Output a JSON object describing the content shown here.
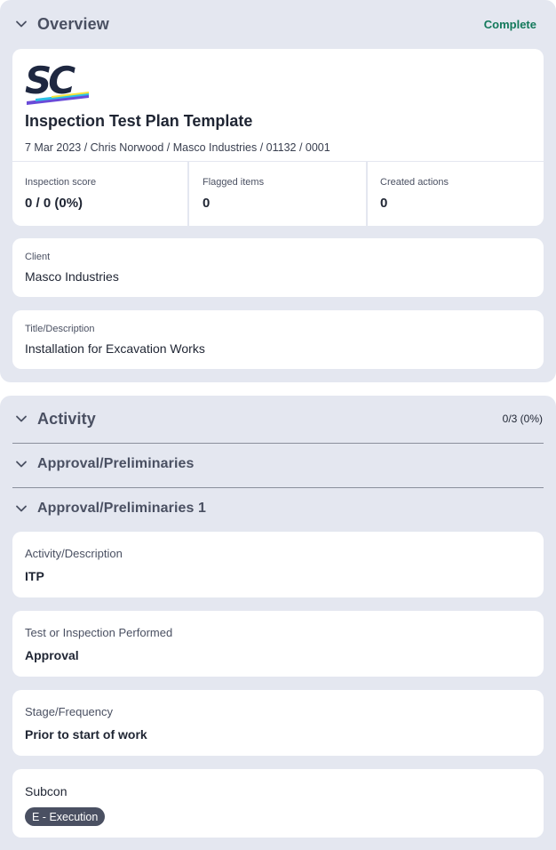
{
  "overview": {
    "title": "Overview",
    "status": "Complete",
    "logo_text": "SC",
    "template_title": "Inspection Test Plan Template",
    "meta": "7 Mar 2023 / Chris Norwood / Masco Industries / 01132 / 0001",
    "stats": [
      {
        "label": "Inspection score",
        "value": "0 / 0 (0%)"
      },
      {
        "label": "Flagged items",
        "value": "0"
      },
      {
        "label": "Created actions",
        "value": "0"
      }
    ],
    "client": {
      "label": "Client",
      "value": "Masco Industries"
    },
    "description": {
      "label": "Title/Description",
      "value": "Installation for Excavation Works"
    }
  },
  "activity": {
    "title": "Activity",
    "progress": "0/3 (0%)",
    "subsections": [
      {
        "title": "Approval/Preliminaries"
      },
      {
        "title": "Approval/Preliminaries 1"
      }
    ],
    "fields": [
      {
        "label": "Activity/Description",
        "value": "ITP"
      },
      {
        "label": "Test or Inspection Performed",
        "value": "Approval"
      },
      {
        "label": "Stage/Frequency",
        "value": "Prior to start of work"
      }
    ],
    "subcon": {
      "label": "Subcon",
      "badge": "E - Execution"
    }
  },
  "colors": {
    "panel_bg": "#e4e7f0",
    "status_green": "#13795b",
    "logo_navy": "#1e2740",
    "logo_yellow": "#f6e43b",
    "logo_cyan": "#2bc1e6",
    "logo_purple": "#6a4bd8",
    "badge_bg": "#4a5062"
  },
  "icons": [
    "chevron-down-icon",
    "sc-logo"
  ]
}
